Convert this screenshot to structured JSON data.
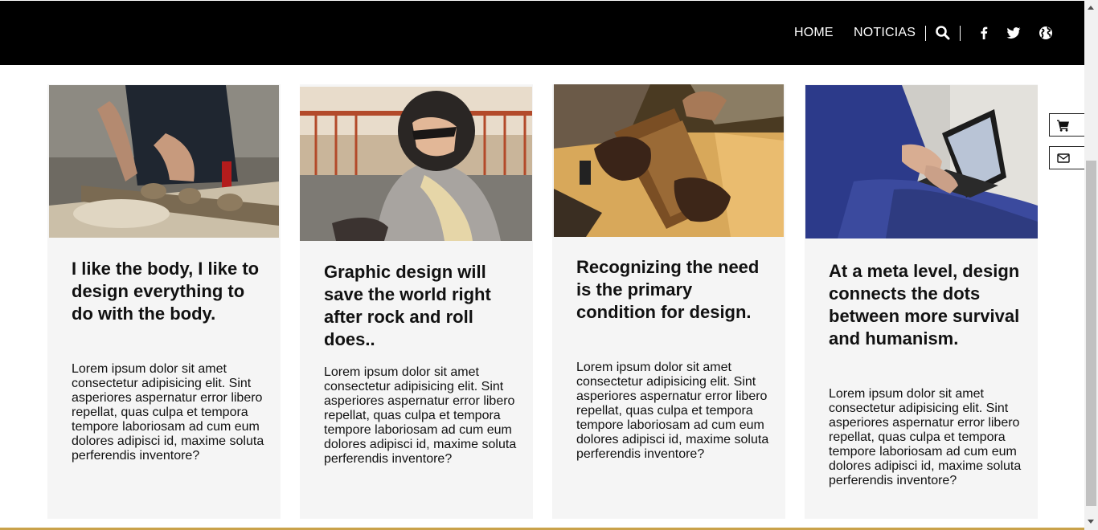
{
  "header": {
    "nav": [
      {
        "label": "HOME"
      },
      {
        "label": "NOTICIAS"
      }
    ],
    "icons": [
      "search-icon",
      "facebook-icon",
      "twitter-icon",
      "globe-icon"
    ],
    "background": "#000000",
    "text_color": "#ffffff"
  },
  "cards": [
    {
      "image": "woodworker-carving-photo",
      "title": "I like the body, I like to design everything to do with the body.",
      "text": "Lorem ipsum dolor sit amet consectetur adipisicing elit. Sint asperiores aspernatur error libero repellat, quas culpa et tempora tempore laboriosam ad cum eum dolores adipisci id, maxime soluta perferendis inventore?"
    },
    {
      "image": "motorcycle-helmet-rider-photo",
      "title": "Graphic design will save the world right after rock and roll does..",
      "text": "Lorem ipsum dolor sit amet consectetur adipisicing elit. Sint asperiores aspernatur error libero repellat, quas culpa et tempora tempore laboriosam ad cum eum dolores adipisci id, maxime soluta perferendis inventore?"
    },
    {
      "image": "leather-craft-hands-photo",
      "title": "Recognizing the need is the primary condition for design.",
      "text": "Lorem ipsum dolor sit amet consectetur adipisicing elit. Sint asperiores aspernatur error libero repellat, quas culpa et tempora tempore laboriosam ad cum eum dolores adipisci id, maxime soluta perferendis inventore?"
    },
    {
      "image": "laptop-on-lap-photo",
      "title": "At a meta level, design connects the dots between more survival and humanism.",
      "text": "Lorem ipsum dolor sit amet consectetur adipisicing elit. Sint asperiores aspernatur error libero repellat, quas culpa et tempora tempore laboriosam ad cum eum dolores adipisci id, maxime soluta perferendis inventore?"
    }
  ],
  "side_buttons": [
    "cart-icon",
    "envelope-icon"
  ],
  "colors": {
    "card_bg": "#f5f5f5",
    "accent_line": "#c9a24a"
  }
}
